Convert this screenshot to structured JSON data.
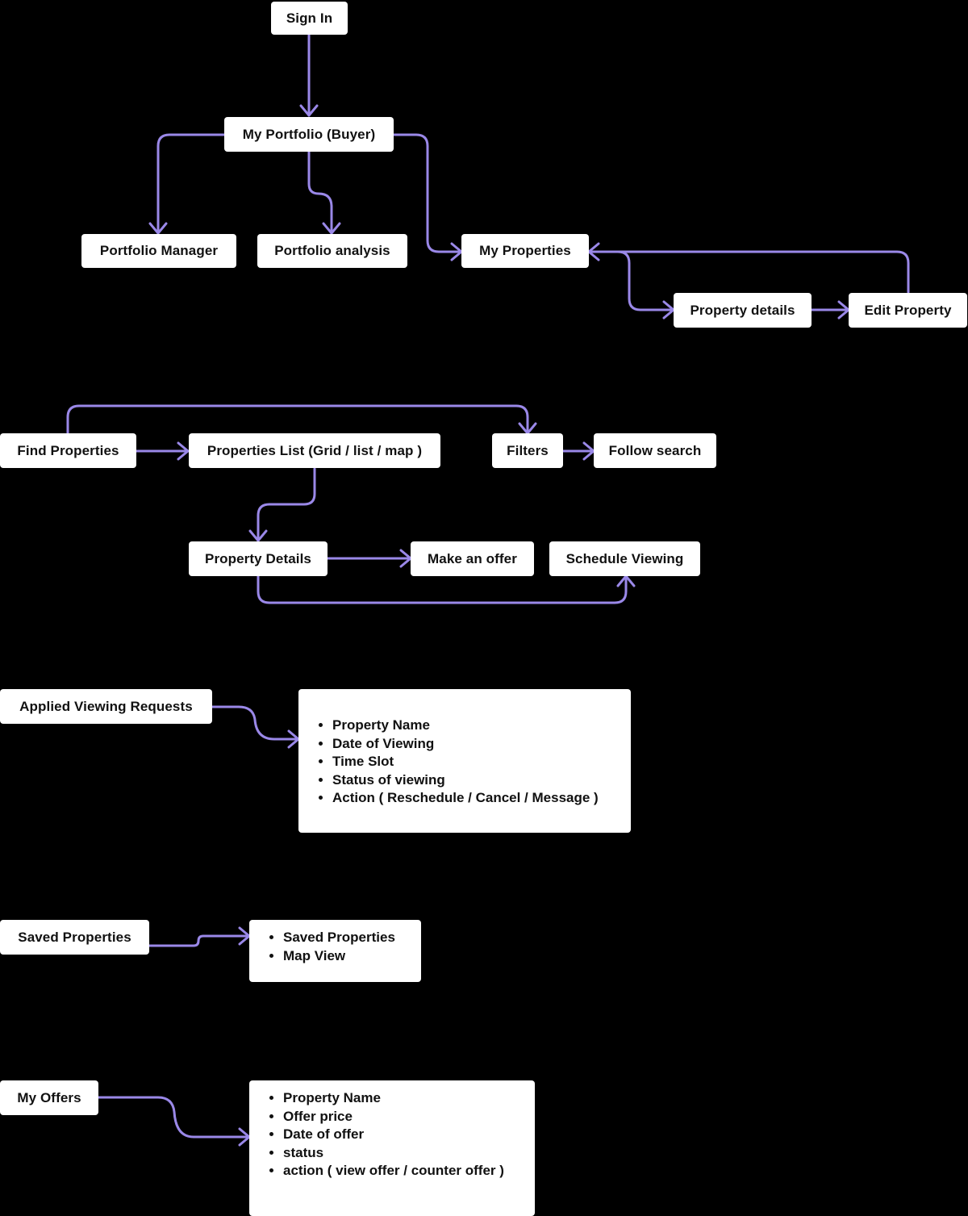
{
  "colors": {
    "background": "#000000",
    "node": "#ffffff",
    "edge": "#9a88e8",
    "text": "#111111"
  },
  "nodes": {
    "sign_in": "Sign In",
    "my_portfolio": "My Portfolio (Buyer)",
    "portfolio_manager": "Portfolio Manager",
    "portfolio_analysis": "Portfolio analysis",
    "my_properties": "My Properties",
    "property_details_owner": "Property details",
    "edit_property": "Edit Property",
    "find_properties": "Find Properties",
    "properties_list": "Properties List (Grid / list / map )",
    "filters": "Filters",
    "follow_search": "Follow search",
    "property_details": "Property Details",
    "make_offer": "Make an offer",
    "schedule_viewing": "Schedule Viewing",
    "applied_viewing_requests": "Applied Viewing Requests",
    "saved_properties": "Saved Properties",
    "my_offers": "My Offers"
  },
  "cards": {
    "viewing_requests_fields": [
      "Property Name",
      "Date of Viewing",
      "Time Slot",
      "Status of viewing",
      "Action ( Reschedule / Cancel / Message )"
    ],
    "saved_properties_fields": [
      "Saved Properties",
      "Map View"
    ],
    "offers_fields": [
      "Property Name",
      "Offer price",
      "Date of offer",
      "status",
      "action ( view offer / counter offer )"
    ]
  },
  "edges": [
    {
      "from": "sign_in",
      "to": "my_portfolio"
    },
    {
      "from": "my_portfolio",
      "to": "portfolio_manager"
    },
    {
      "from": "my_portfolio",
      "to": "portfolio_analysis"
    },
    {
      "from": "my_portfolio",
      "to": "my_properties"
    },
    {
      "from": "my_properties",
      "to": "property_details_owner"
    },
    {
      "from": "property_details_owner",
      "to": "edit_property"
    },
    {
      "from": "edit_property",
      "to": "my_properties"
    },
    {
      "from": "find_properties",
      "to": "properties_list"
    },
    {
      "from": "find_properties",
      "to": "filters"
    },
    {
      "from": "filters",
      "to": "follow_search"
    },
    {
      "from": "properties_list",
      "to": "property_details"
    },
    {
      "from": "property_details",
      "to": "make_offer"
    },
    {
      "from": "property_details",
      "to": "schedule_viewing"
    },
    {
      "from": "applied_viewing_requests",
      "to": "viewing_requests_fields"
    },
    {
      "from": "saved_properties",
      "to": "saved_properties_fields"
    },
    {
      "from": "my_offers",
      "to": "offers_fields"
    }
  ]
}
